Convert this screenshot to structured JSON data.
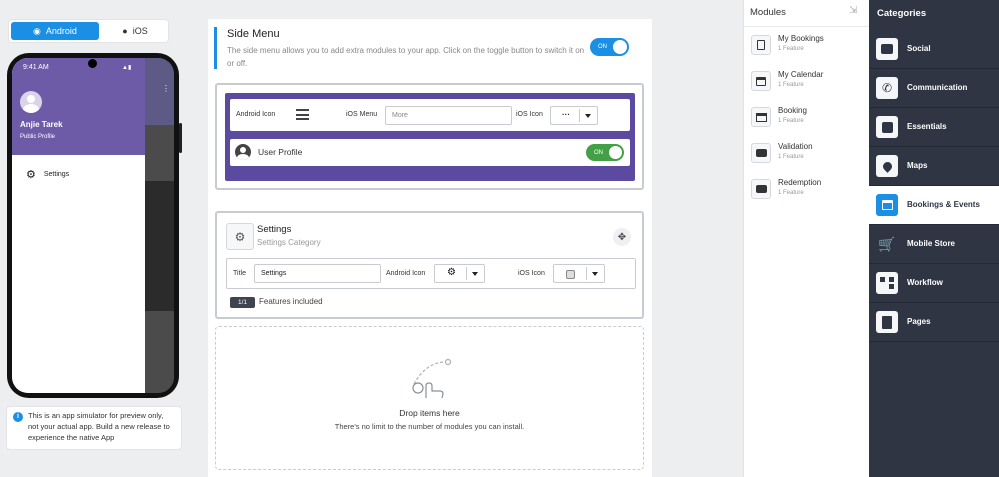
{
  "platform": {
    "android": "Android",
    "ios": "iOS",
    "selected": "Android"
  },
  "phone": {
    "time": "9:41 AM",
    "user_name": "Anjie Tarek",
    "profile_link": "Public Profile",
    "menu_item": "Settings"
  },
  "notice": {
    "text": "This is an app simulator for preview only, not your actual app. Build a new release to experience the native App"
  },
  "side_menu": {
    "title": "Side Menu",
    "description": "The side menu allows you to add extra modules to your app. Click on the toggle button to switch it on or off.",
    "toggle": "ON"
  },
  "menu_config": {
    "android_icon_label": "Android Icon",
    "ios_menu_label": "iOS Menu",
    "ios_menu_placeholder": "More",
    "ios_icon_label": "iOS Icon",
    "ios_icon_value": "···",
    "user_profile_label": "User Profile",
    "user_profile_toggle": "ON"
  },
  "settings_module": {
    "title": "Settings",
    "subtitle": "Settings Category",
    "title_label": "Title",
    "title_value": "Settings",
    "android_icon_label": "Android Icon",
    "ios_icon_label": "iOS Icon",
    "features_badge": "1/1",
    "features_text": "Features included"
  },
  "dropzone": {
    "title": "Drop items here",
    "subtitle": "There's no limit to the number of modules you can install."
  },
  "modules": {
    "header": "Modules",
    "items": [
      {
        "name": "My Bookings",
        "sub": "1 Feature",
        "icon": "clipboard-icon"
      },
      {
        "name": "My Calendar",
        "sub": "1 Feature",
        "icon": "calendar-icon"
      },
      {
        "name": "Booking",
        "sub": "1 Feature",
        "icon": "store-icon"
      },
      {
        "name": "Validation",
        "sub": "1 Feature",
        "icon": "chat-icon"
      },
      {
        "name": "Redemption",
        "sub": "1 Feature",
        "icon": "chat-icon"
      }
    ]
  },
  "categories": {
    "header": "Categories",
    "items": [
      {
        "label": "Social",
        "icon": "social-icon"
      },
      {
        "label": "Communication",
        "icon": "phone-icon"
      },
      {
        "label": "Essentials",
        "icon": "puzzle-icon"
      },
      {
        "label": "Maps",
        "icon": "map-pin-icon"
      },
      {
        "label": "Bookings & Events",
        "icon": "calendar-icon",
        "active": true
      },
      {
        "label": "Mobile Store",
        "icon": "cart-icon"
      },
      {
        "label": "Workflow",
        "icon": "workflow-icon"
      },
      {
        "label": "Pages",
        "icon": "pages-icon"
      }
    ]
  },
  "colors": {
    "accent": "#1a8fe3",
    "purple": "#6e5ba8",
    "toggle_green": "#43a047",
    "sidebar": "#2f3542"
  }
}
